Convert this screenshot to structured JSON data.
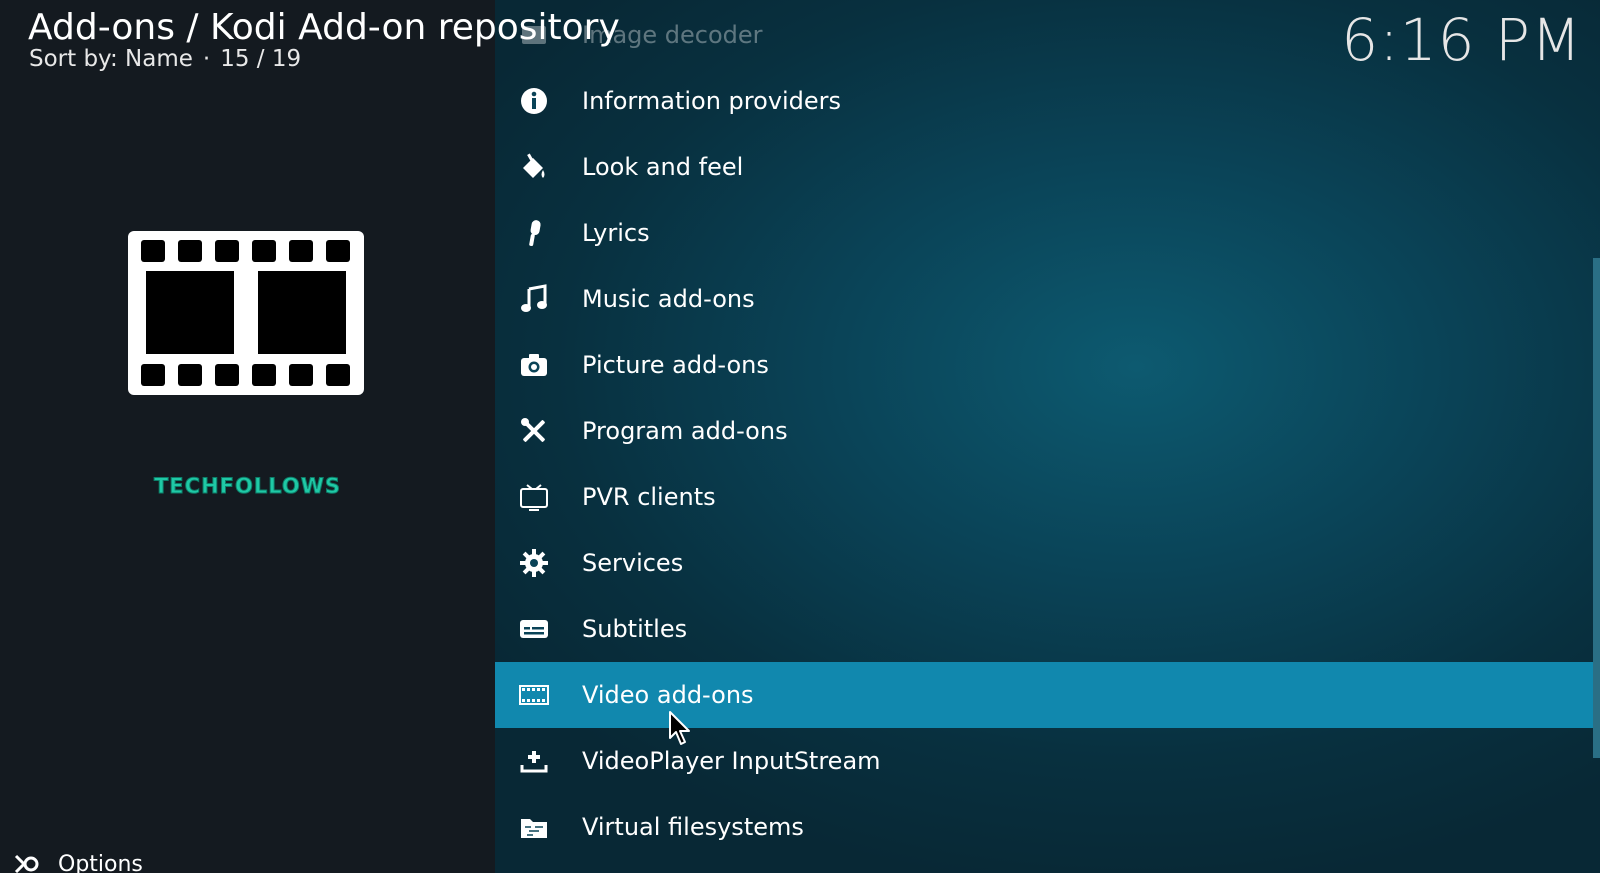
{
  "header": {
    "title": "Add-ons / Kodi Add-on repository",
    "sort_label": "Sort by: Name",
    "separator": "·",
    "position": "15 / 19"
  },
  "clock": "6:16 PM",
  "brand": "TECHFOLLOWS",
  "footer": {
    "options_label": "Options",
    "options_icon": "options-icon"
  },
  "list": {
    "items": [
      {
        "label": "Image decoder",
        "icon": "image-decoder-icon"
      },
      {
        "label": "Information providers",
        "icon": "info-icon"
      },
      {
        "label": "Look and feel",
        "icon": "paint-bucket-icon"
      },
      {
        "label": "Lyrics",
        "icon": "microphone-icon"
      },
      {
        "label": "Music add-ons",
        "icon": "music-note-icon"
      },
      {
        "label": "Picture add-ons",
        "icon": "camera-icon"
      },
      {
        "label": "Program add-ons",
        "icon": "tools-icon"
      },
      {
        "label": "PVR clients",
        "icon": "tv-icon"
      },
      {
        "label": "Services",
        "icon": "gear-icon"
      },
      {
        "label": "Subtitles",
        "icon": "subtitles-icon"
      },
      {
        "label": "Video add-ons",
        "icon": "film-icon"
      },
      {
        "label": "VideoPlayer InputStream",
        "icon": "download-tray-icon"
      },
      {
        "label": "Virtual filesystems",
        "icon": "folder-icon"
      }
    ],
    "selected": "Video add-ons"
  },
  "colors": {
    "selection": "#1188ae",
    "brand": "#1fc9a6",
    "background_left": "#141a20",
    "background_list": "#0a4357"
  }
}
